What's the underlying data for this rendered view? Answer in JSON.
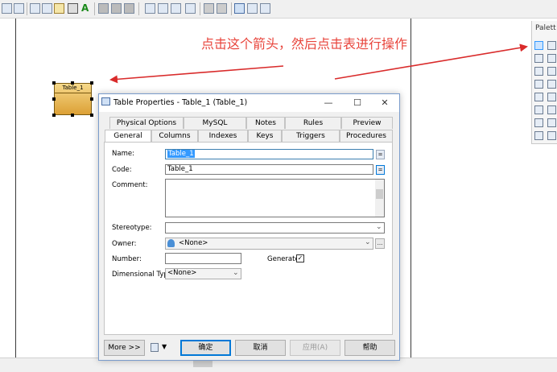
{
  "annotation": {
    "text": "点击这个箭头，然后点击表进行操作"
  },
  "diagram": {
    "table_name": "Table_1"
  },
  "palette": {
    "title": "Palett"
  },
  "dialog": {
    "title": "Table Properties - Table_1 (Table_1)",
    "minimize_glyph": "—",
    "maximize_glyph": "☐",
    "close_glyph": "✕",
    "tabs_row1": [
      "Physical Options",
      "MySQL",
      "Notes",
      "Rules",
      "Preview"
    ],
    "tabs_row2": [
      "General",
      "Columns",
      "Indexes",
      "Keys",
      "Triggers",
      "Procedures"
    ],
    "active_tab": "General",
    "fields": {
      "name_label": "Name:",
      "name_value": "Table_1",
      "code_label": "Code:",
      "code_value": "Table_1",
      "comment_label": "Comment:",
      "comment_value": "",
      "stereotype_label": "Stereotype:",
      "stereotype_value": "",
      "owner_label": "Owner:",
      "owner_value": "<None>",
      "number_label": "Number:",
      "number_value": "",
      "generate_label": "Generate:",
      "generate_checked": true,
      "dimensional_label": "Dimensional Type:",
      "dimensional_value": "<None>",
      "ellipsis": "...",
      "equals": "="
    },
    "buttons": {
      "more": "More >>",
      "ok": "确定",
      "cancel": "取消",
      "apply": "应用(A)",
      "help": "帮助"
    }
  },
  "colors": {
    "annotation": "#e8453c",
    "arrow": "#d92b2b",
    "accent": "#0078d7"
  }
}
